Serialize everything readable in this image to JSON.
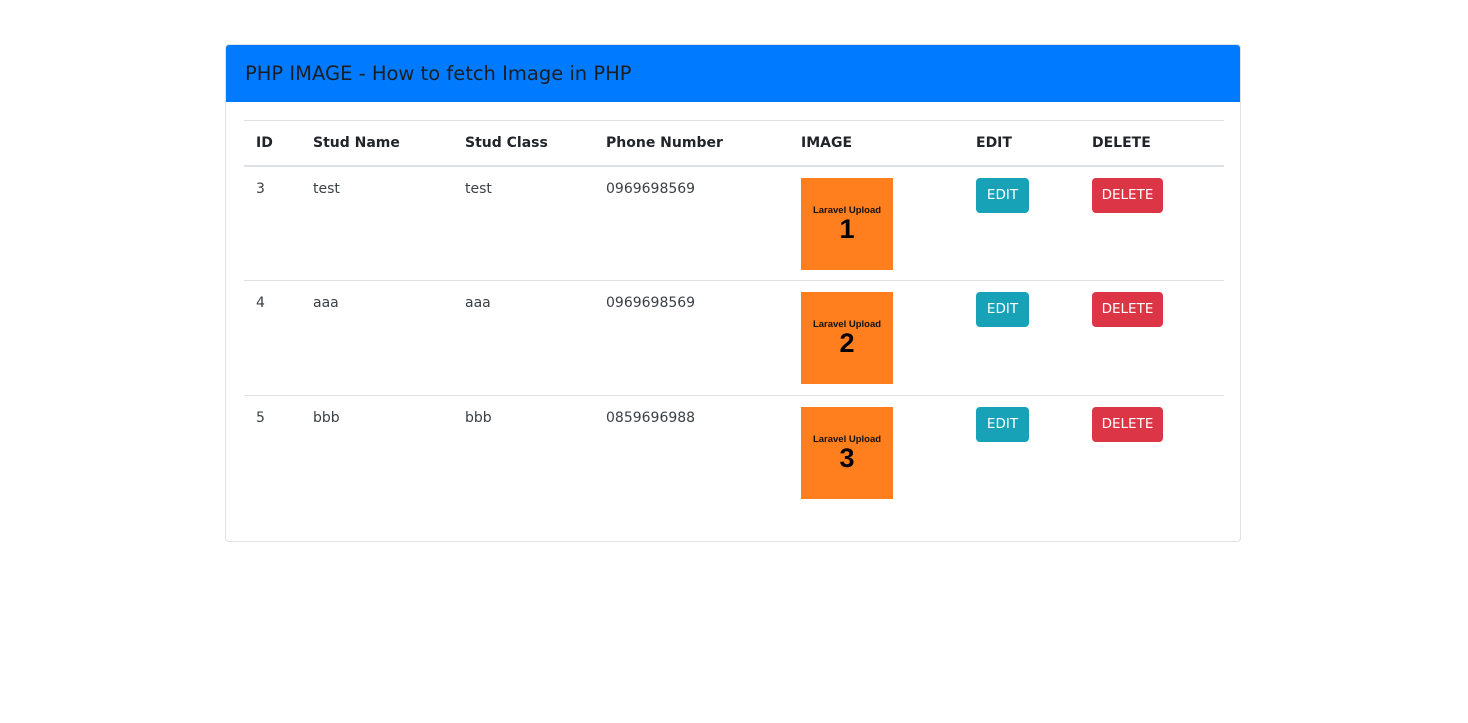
{
  "header": {
    "title": "PHP IMAGE - How to fetch Image in PHP"
  },
  "colors": {
    "header_bg": "#007bff",
    "edit_button": "#17a2b8",
    "delete_button": "#dc3545",
    "thumbnail_bg": "#ff7f1e"
  },
  "table": {
    "columns": [
      "ID",
      "Stud Name",
      "Stud Class",
      "Phone Number",
      "IMAGE",
      "EDIT",
      "DELETE"
    ],
    "rows": [
      {
        "id": "3",
        "name": "test",
        "class": "test",
        "phone": "0969698569",
        "image": {
          "caption": "Laravel Upload",
          "number": "1"
        },
        "edit_label": "EDIT",
        "delete_label": "DELETE"
      },
      {
        "id": "4",
        "name": "aaa",
        "class": "aaa",
        "phone": "0969698569",
        "image": {
          "caption": "Laravel Upload",
          "number": "2"
        },
        "edit_label": "EDIT",
        "delete_label": "DELETE"
      },
      {
        "id": "5",
        "name": "bbb",
        "class": "bbb",
        "phone": "0859696988",
        "image": {
          "caption": "Laravel Upload",
          "number": "3"
        },
        "edit_label": "EDIT",
        "delete_label": "DELETE"
      }
    ]
  }
}
